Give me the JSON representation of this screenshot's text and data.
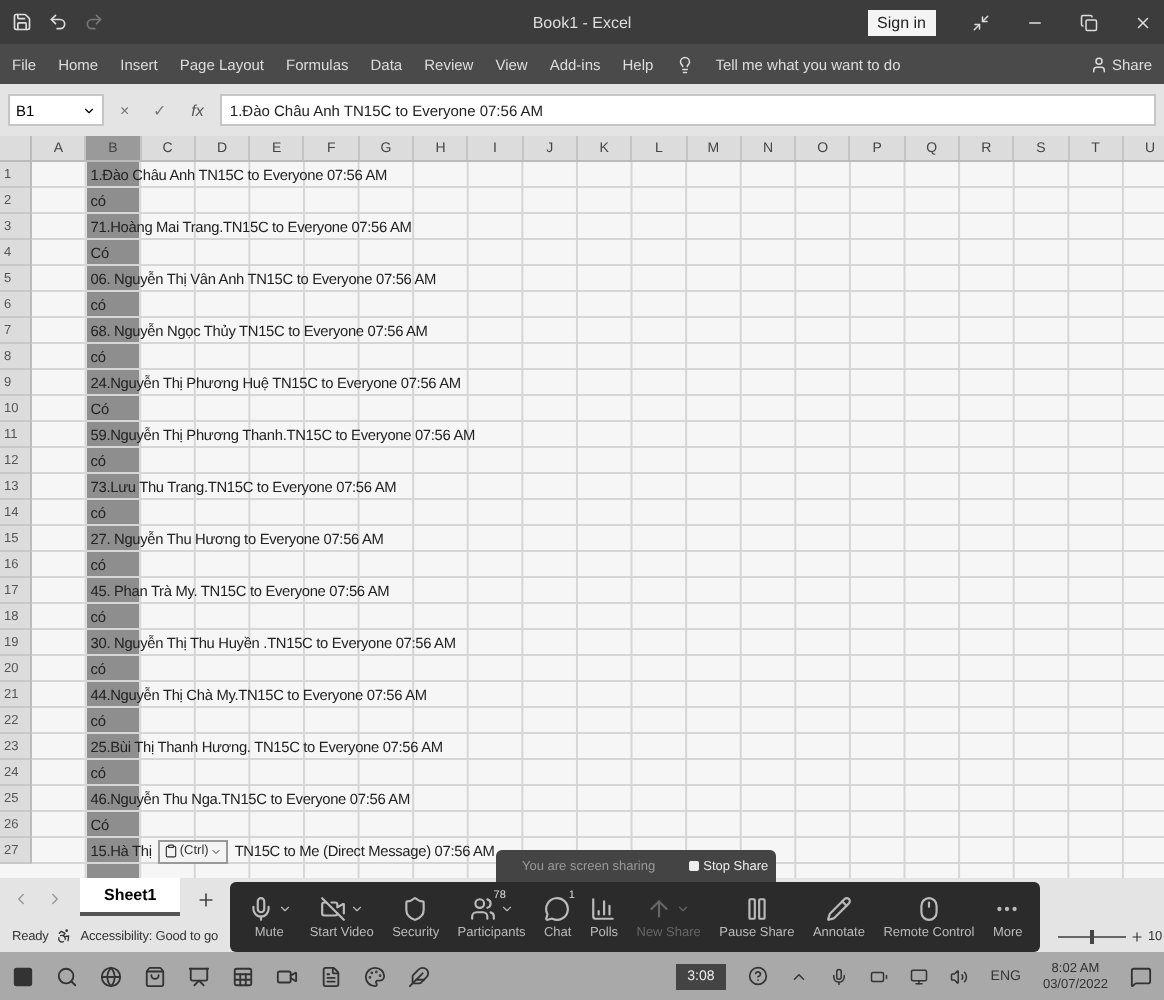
{
  "window": {
    "title": "Book1 - Excel",
    "sign_in": "Sign in"
  },
  "ribbon": {
    "tabs": [
      "File",
      "Home",
      "Insert",
      "Page Layout",
      "Formulas",
      "Data",
      "Review",
      "View",
      "Add-ins",
      "Help"
    ],
    "tell_me": "Tell me what you want to do",
    "share": "Share"
  },
  "formula_bar": {
    "name_box": "B1",
    "cancel": "×",
    "enter": "✓",
    "fx": "fx",
    "value": "1.Đào Châu Anh TN15C to Everyone 07:56 AM"
  },
  "columns": [
    {
      "label": "A",
      "selected": false
    },
    {
      "label": "B",
      "selected": true
    },
    {
      "label": "C",
      "selected": false
    },
    {
      "label": "D",
      "selected": false
    },
    {
      "label": "E",
      "selected": false
    },
    {
      "label": "F",
      "selected": false
    },
    {
      "label": "G",
      "selected": false
    },
    {
      "label": "H",
      "selected": false
    },
    {
      "label": "I",
      "selected": false
    },
    {
      "label": "J",
      "selected": false
    },
    {
      "label": "K",
      "selected": false
    },
    {
      "label": "L",
      "selected": false
    },
    {
      "label": "M",
      "selected": false
    },
    {
      "label": "N",
      "selected": false
    },
    {
      "label": "O",
      "selected": false
    },
    {
      "label": "P",
      "selected": false
    },
    {
      "label": "Q",
      "selected": false
    },
    {
      "label": "R",
      "selected": false
    },
    {
      "label": "S",
      "selected": false
    },
    {
      "label": "T",
      "selected": false
    },
    {
      "label": "U",
      "selected": false
    }
  ],
  "rows": [
    {
      "number": "1",
      "text": "1.Đào Châu Anh TN15C to Everyone 07:56 AM"
    },
    {
      "number": "2",
      "text": "có"
    },
    {
      "number": "3",
      "text": "71.Hoàng Mai Trang.TN15C to Everyone 07:56 AM"
    },
    {
      "number": "4",
      "text": "Có"
    },
    {
      "number": "5",
      "text": "06. Nguyễn Thị Vân Anh TN15C to Everyone 07:56 AM"
    },
    {
      "number": "6",
      "text": "có"
    },
    {
      "number": "7",
      "text": "68. Nguyễn Ngọc Thủy TN15C to Everyone 07:56 AM"
    },
    {
      "number": "8",
      "text": "có"
    },
    {
      "number": "9",
      "text": "24.Nguyễn Thị Phương Huệ TN15C to Everyone 07:56 AM"
    },
    {
      "number": "10",
      "text": "Có"
    },
    {
      "number": "11",
      "text": "59.Nguyễn Thị Phương Thanh.TN15C to Everyone 07:56 AM"
    },
    {
      "number": "12",
      "text": "có"
    },
    {
      "number": "13",
      "text": "73.Lưu Thu Trang.TN15C to Everyone 07:56 AM"
    },
    {
      "number": "14",
      "text": "có"
    },
    {
      "number": "15",
      "text": "27. Nguyễn Thu Hương to Everyone 07:56 AM"
    },
    {
      "number": "16",
      "text": "có"
    },
    {
      "number": "17",
      "text": "45. Phan Trà My. TN15C to Everyone 07:56 AM"
    },
    {
      "number": "18",
      "text": "có"
    },
    {
      "number": "19",
      "text": "30. Nguyễn Thị Thu Huyền .TN15C to Everyone 07:56 AM"
    },
    {
      "number": "20",
      "text": "có"
    },
    {
      "number": "21",
      "text": "44.Nguyễn Thị Chà My.TN15C to Everyone 07:56 AM"
    },
    {
      "number": "22",
      "text": "có"
    },
    {
      "number": "23",
      "text": "25.Bùi Thị Thanh Hương. TN15C to Everyone 07:56 AM"
    },
    {
      "number": "24",
      "text": "có"
    },
    {
      "number": "25",
      "text": "46.Nguyễn Thu Nga.TN15C to Everyone 07:56 AM"
    },
    {
      "number": "26",
      "text": "Có"
    },
    {
      "number": "27",
      "text": "15.Hà Thị",
      "paste_options": "(Ctrl)",
      "text_after": "TN15C to Me (Direct Message) 07:56 AM"
    }
  ],
  "sheet_tabs": [
    {
      "label": "Sheet1",
      "selected": true
    }
  ],
  "status_bar": {
    "status": "Ready",
    "accessibility": "Accessibility: Good to go",
    "zoom": "10",
    "zoom_slider": {
      "level": 0.5
    }
  },
  "sharing_banner": {
    "text": "You are screen sharing",
    "stop": "Stop Share"
  },
  "meeting_toolbar": [
    {
      "kind": "mute",
      "label": "Mute",
      "caret": true,
      "disabled": false
    },
    {
      "kind": "video",
      "label": "Start Video",
      "caret": true,
      "disabled": false
    },
    {
      "kind": "security",
      "label": "Security",
      "caret": false,
      "disabled": false
    },
    {
      "kind": "participants",
      "label": "Participants",
      "badge": "78",
      "caret": true,
      "disabled": false
    },
    {
      "kind": "chat",
      "label": "Chat",
      "badge": "1",
      "caret": false,
      "disabled": false
    },
    {
      "kind": "polls",
      "label": "Polls",
      "caret": false,
      "disabled": false
    },
    {
      "kind": "share",
      "label": "New Share",
      "caret": true,
      "disabled": true
    },
    {
      "kind": "pause",
      "label": "Pause Share",
      "caret": false,
      "disabled": false
    },
    {
      "kind": "annotate",
      "label": "Annotate",
      "caret": false,
      "disabled": false
    },
    {
      "kind": "remote",
      "label": "Remote Control",
      "caret": false,
      "disabled": false
    },
    {
      "kind": "more",
      "label": "More",
      "caret": false,
      "disabled": false
    }
  ],
  "taskbar": {
    "timer": "3:08",
    "language": "ENG",
    "time": "8:02 AM",
    "date": "03/07/2022"
  }
}
